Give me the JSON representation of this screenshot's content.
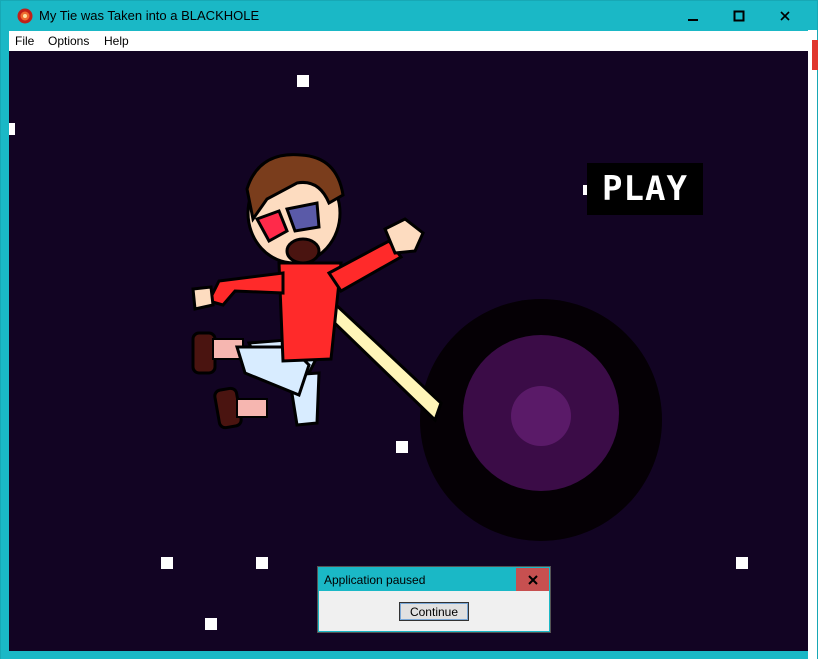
{
  "window": {
    "title": "My Tie was Taken into a BLACKHOLE",
    "controls": [
      "minimize",
      "maximize",
      "close"
    ]
  },
  "menu": {
    "items": [
      {
        "label": "File"
      },
      {
        "label": "Options"
      },
      {
        "label": "Help"
      }
    ]
  },
  "game": {
    "play_label": "PLAY",
    "background_color": "#120423",
    "blackhole_colors": [
      "#050005",
      "#3b0c47",
      "#5a1a68"
    ],
    "character_colors": {
      "shirt": "#ff2a2a",
      "tie": "#fff5b8",
      "hair": "#7a3d1c",
      "pants": "#d8ecff"
    }
  },
  "dialog": {
    "title": "Application paused",
    "continue_label": "Continue"
  },
  "icons": {
    "app": "blackhole-app-icon",
    "close": "close-icon",
    "minimize": "minimize-icon",
    "maximize": "maximize-icon"
  }
}
